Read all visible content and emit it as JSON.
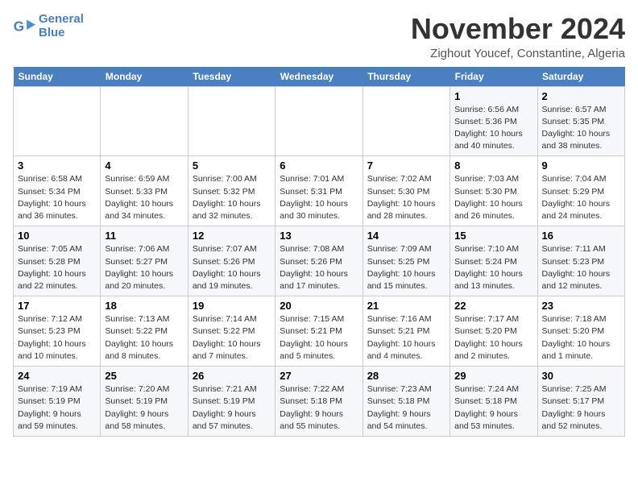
{
  "header": {
    "logo_line1": "General",
    "logo_line2": "Blue",
    "month": "November 2024",
    "location": "Zighout Youcef, Constantine, Algeria"
  },
  "days_of_week": [
    "Sunday",
    "Monday",
    "Tuesday",
    "Wednesday",
    "Thursday",
    "Friday",
    "Saturday"
  ],
  "weeks": [
    [
      {
        "day": "",
        "info": ""
      },
      {
        "day": "",
        "info": ""
      },
      {
        "day": "",
        "info": ""
      },
      {
        "day": "",
        "info": ""
      },
      {
        "day": "",
        "info": ""
      },
      {
        "day": "1",
        "info": "Sunrise: 6:56 AM\nSunset: 5:36 PM\nDaylight: 10 hours and 40 minutes."
      },
      {
        "day": "2",
        "info": "Sunrise: 6:57 AM\nSunset: 5:35 PM\nDaylight: 10 hours and 38 minutes."
      }
    ],
    [
      {
        "day": "3",
        "info": "Sunrise: 6:58 AM\nSunset: 5:34 PM\nDaylight: 10 hours and 36 minutes."
      },
      {
        "day": "4",
        "info": "Sunrise: 6:59 AM\nSunset: 5:33 PM\nDaylight: 10 hours and 34 minutes."
      },
      {
        "day": "5",
        "info": "Sunrise: 7:00 AM\nSunset: 5:32 PM\nDaylight: 10 hours and 32 minutes."
      },
      {
        "day": "6",
        "info": "Sunrise: 7:01 AM\nSunset: 5:31 PM\nDaylight: 10 hours and 30 minutes."
      },
      {
        "day": "7",
        "info": "Sunrise: 7:02 AM\nSunset: 5:30 PM\nDaylight: 10 hours and 28 minutes."
      },
      {
        "day": "8",
        "info": "Sunrise: 7:03 AM\nSunset: 5:30 PM\nDaylight: 10 hours and 26 minutes."
      },
      {
        "day": "9",
        "info": "Sunrise: 7:04 AM\nSunset: 5:29 PM\nDaylight: 10 hours and 24 minutes."
      }
    ],
    [
      {
        "day": "10",
        "info": "Sunrise: 7:05 AM\nSunset: 5:28 PM\nDaylight: 10 hours and 22 minutes."
      },
      {
        "day": "11",
        "info": "Sunrise: 7:06 AM\nSunset: 5:27 PM\nDaylight: 10 hours and 20 minutes."
      },
      {
        "day": "12",
        "info": "Sunrise: 7:07 AM\nSunset: 5:26 PM\nDaylight: 10 hours and 19 minutes."
      },
      {
        "day": "13",
        "info": "Sunrise: 7:08 AM\nSunset: 5:26 PM\nDaylight: 10 hours and 17 minutes."
      },
      {
        "day": "14",
        "info": "Sunrise: 7:09 AM\nSunset: 5:25 PM\nDaylight: 10 hours and 15 minutes."
      },
      {
        "day": "15",
        "info": "Sunrise: 7:10 AM\nSunset: 5:24 PM\nDaylight: 10 hours and 13 minutes."
      },
      {
        "day": "16",
        "info": "Sunrise: 7:11 AM\nSunset: 5:23 PM\nDaylight: 10 hours and 12 minutes."
      }
    ],
    [
      {
        "day": "17",
        "info": "Sunrise: 7:12 AM\nSunset: 5:23 PM\nDaylight: 10 hours and 10 minutes."
      },
      {
        "day": "18",
        "info": "Sunrise: 7:13 AM\nSunset: 5:22 PM\nDaylight: 10 hours and 8 minutes."
      },
      {
        "day": "19",
        "info": "Sunrise: 7:14 AM\nSunset: 5:22 PM\nDaylight: 10 hours and 7 minutes."
      },
      {
        "day": "20",
        "info": "Sunrise: 7:15 AM\nSunset: 5:21 PM\nDaylight: 10 hours and 5 minutes."
      },
      {
        "day": "21",
        "info": "Sunrise: 7:16 AM\nSunset: 5:21 PM\nDaylight: 10 hours and 4 minutes."
      },
      {
        "day": "22",
        "info": "Sunrise: 7:17 AM\nSunset: 5:20 PM\nDaylight: 10 hours and 2 minutes."
      },
      {
        "day": "23",
        "info": "Sunrise: 7:18 AM\nSunset: 5:20 PM\nDaylight: 10 hours and 1 minute."
      }
    ],
    [
      {
        "day": "24",
        "info": "Sunrise: 7:19 AM\nSunset: 5:19 PM\nDaylight: 9 hours and 59 minutes."
      },
      {
        "day": "25",
        "info": "Sunrise: 7:20 AM\nSunset: 5:19 PM\nDaylight: 9 hours and 58 minutes."
      },
      {
        "day": "26",
        "info": "Sunrise: 7:21 AM\nSunset: 5:19 PM\nDaylight: 9 hours and 57 minutes."
      },
      {
        "day": "27",
        "info": "Sunrise: 7:22 AM\nSunset: 5:18 PM\nDaylight: 9 hours and 55 minutes."
      },
      {
        "day": "28",
        "info": "Sunrise: 7:23 AM\nSunset: 5:18 PM\nDaylight: 9 hours and 54 minutes."
      },
      {
        "day": "29",
        "info": "Sunrise: 7:24 AM\nSunset: 5:18 PM\nDaylight: 9 hours and 53 minutes."
      },
      {
        "day": "30",
        "info": "Sunrise: 7:25 AM\nSunset: 5:17 PM\nDaylight: 9 hours and 52 minutes."
      }
    ]
  ]
}
